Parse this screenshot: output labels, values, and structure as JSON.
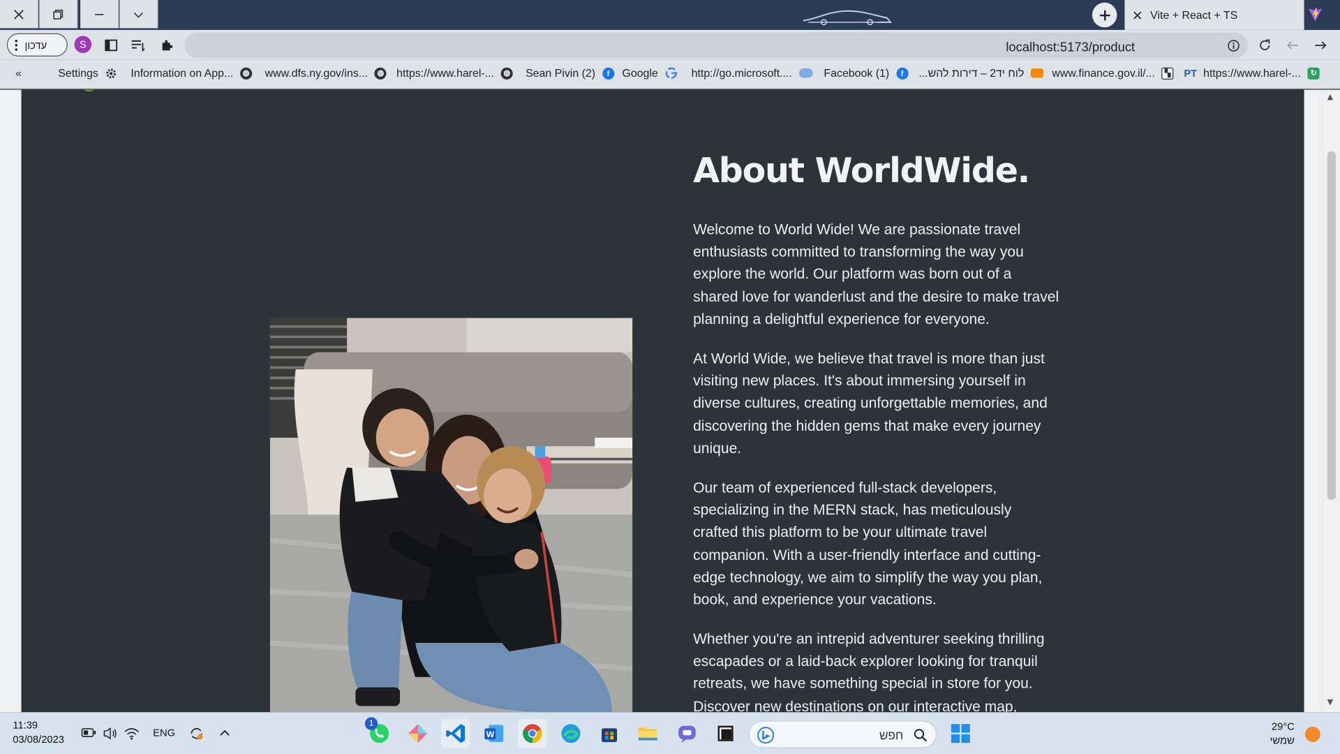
{
  "browser": {
    "tab_title": "Vite + React + TS",
    "url": "localhost:5173/product",
    "update_button_label": "עדכון",
    "profile_initial": "S"
  },
  "bookmarks": [
    {
      "label": "Settings",
      "icon": "gear-icon"
    },
    {
      "label": "Information on App...",
      "icon": "globe-icon"
    },
    {
      "label": "www.dfs.ny.gov/ins...",
      "icon": "globe-icon"
    },
    {
      "label": "https://www.harel-...",
      "icon": "globe-icon"
    },
    {
      "label": "Sean Pivin (2)",
      "icon": "facebook-icon"
    },
    {
      "label": "Google",
      "icon": "google-icon"
    },
    {
      "label": "http://go.microsoft....",
      "icon": "cloud-icon"
    },
    {
      "label": "Facebook (1)",
      "icon": "facebook-icon"
    },
    {
      "label": "לוח יד2 – דירות להש...",
      "icon": "yad2-icon"
    },
    {
      "label": "www.finance.gov.il/...",
      "icon": "finance-icon"
    },
    {
      "label": "https://www.harel-...",
      "icon": "harel-icon"
    }
  ],
  "page": {
    "heading": "About WorldWide.",
    "paragraphs": [
      "Welcome to World Wide! We are passionate travel enthusiasts committed to transforming the way you explore the world. Our platform was born out of a shared love for wanderlust and the desire to make travel planning a delightful experience for everyone.",
      "At World Wide, we believe that travel is more than just visiting new places. It's about immersing yourself in diverse cultures, creating unforgettable memories, and discovering the hidden gems that make every journey unique.",
      "Our team of experienced full-stack developers, specializing in the MERN stack, has meticulously crafted this platform to be your ultimate travel companion. With a user-friendly interface and cutting-edge technology, we aim to simplify the way you plan, book, and experience your vacations.",
      "Whether you're an intrepid adventurer seeking thrilling escapades or a laid-back explorer looking for tranquil retreats, we have something special in store for you. Discover new destinations on our interactive map,"
    ]
  },
  "taskbar": {
    "time": "11:39",
    "date": "03/08/2023",
    "language": "ENG",
    "search_placeholder": "חפש",
    "temperature": "29°C",
    "weather_desc": "שמשי",
    "whatsapp_badge": "1"
  },
  "colors": {
    "page_bg": "#2d3439",
    "heading": "#f1f3f5",
    "text": "#eceff1",
    "titlebar": "#2b3a55"
  }
}
